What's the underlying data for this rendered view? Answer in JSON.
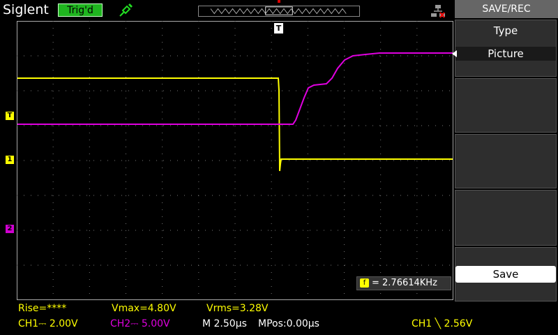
{
  "header": {
    "brand": "Siglent",
    "trigger_status": "Trig'd"
  },
  "menu": {
    "title": "SAVE/REC",
    "type_label": "Type",
    "type_value": "Picture",
    "save_label": "Save"
  },
  "trigger_marker_label": "T",
  "markers": {
    "trig_level": "T",
    "ch1": "1",
    "ch2": "2"
  },
  "frequency": {
    "badge": "f",
    "value": "= 2.76614KHz"
  },
  "measurements": {
    "rise": "Rise=****",
    "vmax": "Vmax=4.80V",
    "vrms": "Vrms=3.28V"
  },
  "status": {
    "ch1": "CH1⎓ 2.00V",
    "ch2": "CH2⎓ 5.00V",
    "timebase": "M 2.50µs",
    "mpos": "MPos:0.00µs",
    "trigger": "CH1 ╲ 2.56V"
  },
  "colors": {
    "ch1": "#ffff00",
    "ch2": "#e000e0",
    "trig_badge": "#1fb51f"
  }
}
